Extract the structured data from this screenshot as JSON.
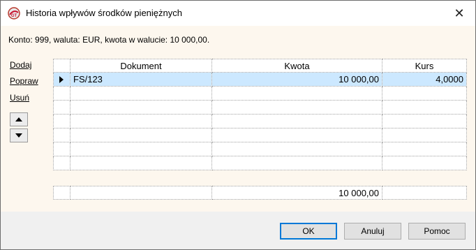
{
  "window": {
    "title": "Historia wpływów środków pieniężnych",
    "close_glyph": "✕"
  },
  "info": {
    "text": "Konto: 999, waluta: EUR, kwota w walucie: 10 000,00."
  },
  "side": {
    "add": "Dodaj",
    "edit": "Popraw",
    "delete": "Usuń"
  },
  "table": {
    "headers": [
      "Dokument",
      "Kwota",
      "Kurs"
    ],
    "rows": [
      {
        "doc": "FS/123",
        "amount": "10 000,00",
        "rate": "4,0000",
        "selected": true
      }
    ],
    "empty_rows": 6
  },
  "totals": {
    "amount": "10 000,00"
  },
  "buttons": {
    "ok": "OK",
    "cancel": "Anuluj",
    "help": "Pomoc"
  },
  "colors": {
    "selected_row": "#cce8ff",
    "content_bg": "#fdf7ee",
    "default_button_border": "#0078d7"
  }
}
